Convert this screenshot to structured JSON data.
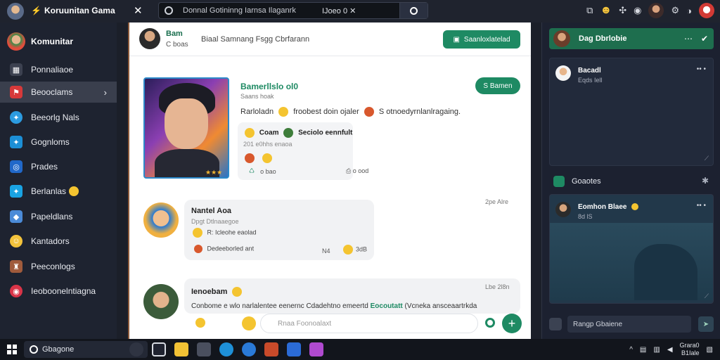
{
  "topbar": {
    "title": "Koruunitan Gama",
    "close": "✕",
    "search_text": "Donnal Gotininng Iarnsa Ilaganrk",
    "search_value": "IJoeo",
    "search_value_extra": "0 ✕"
  },
  "sidebar": {
    "profile_name": "Komunitar",
    "items": [
      {
        "label": "Ponnaliaoe",
        "icon": "dice-icon",
        "color": "#3c4150"
      },
      {
        "label": "Beooclams",
        "icon": "flag-icon",
        "color": "#d6393a"
      },
      {
        "label": "Beeorlg Nals",
        "icon": "twitter-icon",
        "color": "#2c9be0"
      },
      {
        "label": "Gognloms",
        "icon": "twitter-icon",
        "color": "#1c8fd6"
      },
      {
        "label": "Prades",
        "icon": "instagram-icon",
        "color": "#2168c9"
      },
      {
        "label": "Berlanlas",
        "icon": "twitter-icon",
        "color": "#19a3e3"
      },
      {
        "label": "Papeldlans",
        "icon": "puzzle-icon",
        "color": "#4b8bd8"
      },
      {
        "label": "Kantadors",
        "icon": "smiley-icon",
        "color": "#f3c33c"
      },
      {
        "label": "Peeconlogs",
        "icon": "avatar-icon",
        "color": "#a05b3c"
      },
      {
        "label": "Ieoboonelntiagna",
        "icon": "record-icon",
        "color": "#d93448"
      }
    ]
  },
  "feed": {
    "header_name": "Bam",
    "header_sub": "C boas",
    "header_title": "Biaal Samnang Fsgg Cbrfarann",
    "header_button": "Saanloxlatelad",
    "post": {
      "name": "Bamerllslo ol0",
      "sub": "Saans hoak",
      "text_a": "Rarloladn",
      "text_b": "froobest doin ojaler",
      "text_c": "S otnoedyrnlanlragaing.",
      "follow_button": "S Bamen",
      "quote_line_a": "Coam",
      "quote_line_b": "Seciolo eennfult",
      "quote_sub": "201 e0hhs enaoa",
      "like_count": "o bao",
      "bookmark_count": "o ood"
    },
    "comment1": {
      "name": "Nantel Aoa",
      "sub": "Dpgt Dtlnaaegoe",
      "react_text": "R: Icleohe eaolad",
      "reply_text": "Dedeeborled ant",
      "reply_count": "N4",
      "react_count": "3dB",
      "time": "2pe Alre"
    },
    "comment2": {
      "name": "Ienoebam",
      "text_a": "Conbome e wlo narlalentee eenernc Cdadehtno emeertd",
      "text_hl": "Eocoutatt",
      "text_b": "(Vcneka ansceaartrkda",
      "time": "Lbe 2l8n"
    },
    "composer_placeholder": "Rnaa Foonoalaxt"
  },
  "right_panel": {
    "header_title": "Dag Dbrlobie",
    "card1_name": "Bacadl",
    "card1_sub": "Eqds Iell",
    "section_title": "Goaotes",
    "card2_name": "Eomhon Blaee",
    "card2_sub": "8d lS",
    "input_placeholder": "Rangp Gbaiene"
  },
  "taskbar": {
    "search": "Gbagone",
    "clock_time": "Grara0",
    "clock_date": "B1Iale"
  },
  "colors": {
    "accent": "#1e8a63",
    "sidebar_bg": "#1e2330",
    "active_item": "#3a3f4d"
  }
}
